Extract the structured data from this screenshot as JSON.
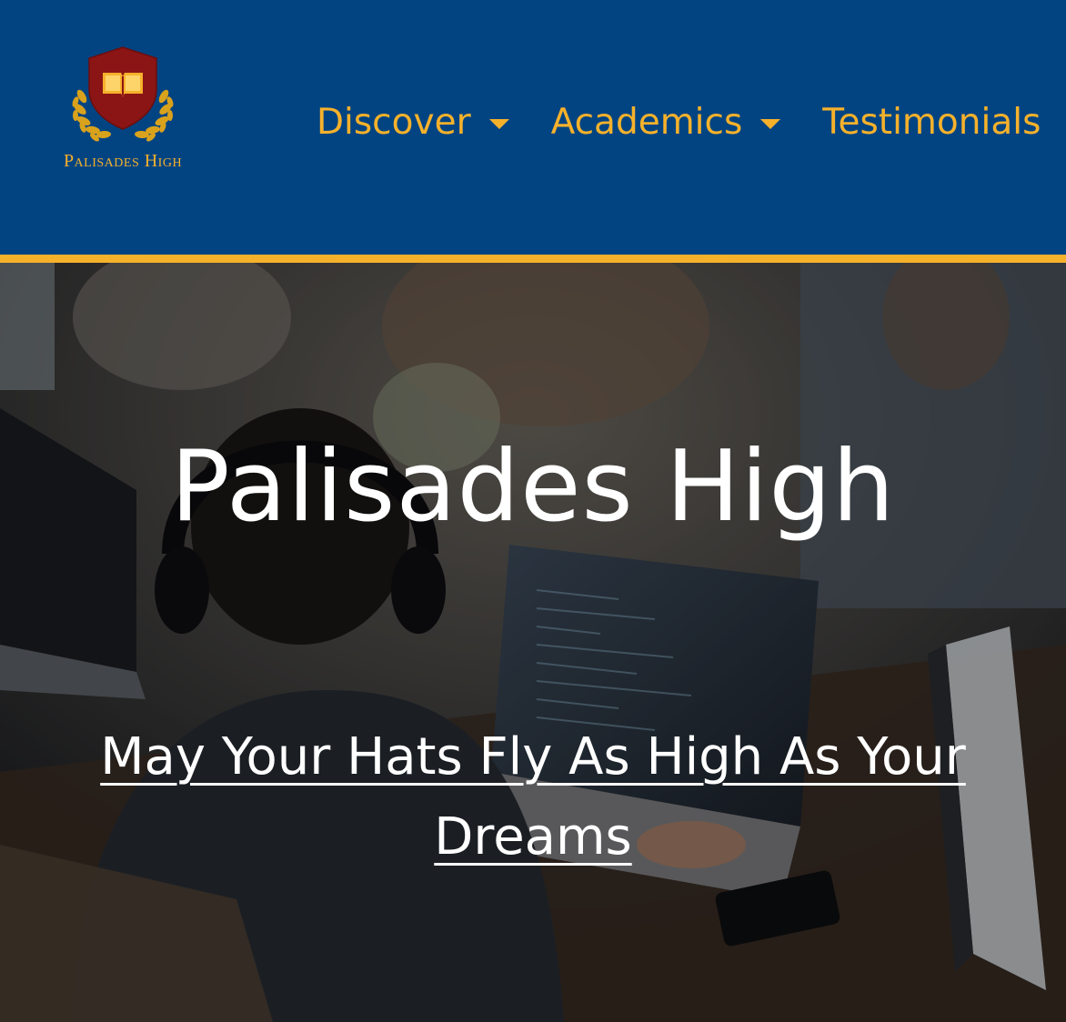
{
  "header": {
    "logo_text": "Palisades High",
    "nav": [
      {
        "label": "Discover",
        "has_dropdown": true
      },
      {
        "label": "Academics",
        "has_dropdown": true
      },
      {
        "label": "Testimonials",
        "has_dropdown": false
      }
    ]
  },
  "hero": {
    "title": "Palisades High",
    "tagline": "May Your Hats Fly As High As Your Dreams"
  },
  "colors": {
    "header_bg": "#024482",
    "accent": "#f6b12b",
    "shield": "#8b1515",
    "hero_text": "#ffffff"
  },
  "icons": {
    "logo": "shield-book-laurel-icon",
    "dropdown": "caret-down-icon"
  }
}
